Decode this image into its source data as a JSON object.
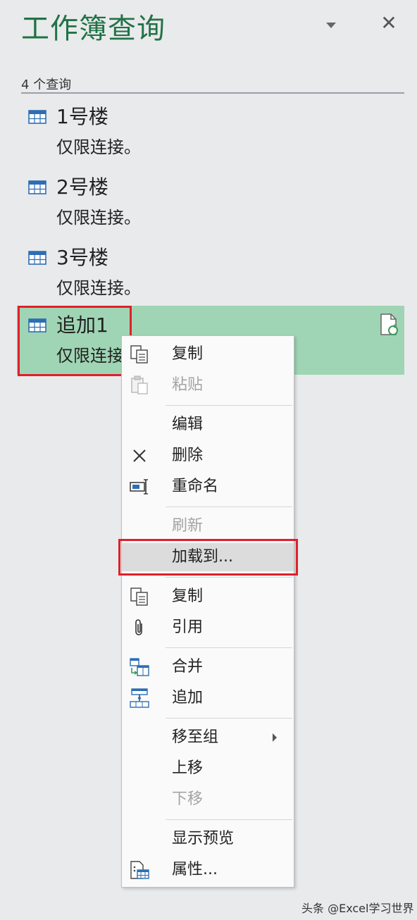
{
  "panel": {
    "title": "工作簿查询",
    "query_count": "4 个查询"
  },
  "queries": [
    {
      "name": "1号楼",
      "status": "仅限连接。"
    },
    {
      "name": "2号楼",
      "status": "仅限连接。"
    },
    {
      "name": "3号楼",
      "status": "仅限连接。"
    },
    {
      "name": "追加1",
      "status": "仅限连接。",
      "selected": true
    }
  ],
  "context_menu": {
    "items": [
      {
        "label": "复制",
        "icon": "copy-icon",
        "enabled": true
      },
      {
        "label": "粘贴",
        "icon": "paste-icon",
        "enabled": false
      },
      {
        "label": "编辑",
        "icon": "",
        "enabled": true
      },
      {
        "label": "删除",
        "icon": "delete-x-icon",
        "enabled": true
      },
      {
        "label": "重命名",
        "icon": "rename-icon",
        "enabled": true
      },
      {
        "label": "刷新",
        "icon": "",
        "enabled": false
      },
      {
        "label": "加载到...",
        "icon": "",
        "enabled": true,
        "highlighted": true
      },
      {
        "label": "复制",
        "icon": "duplicate-icon",
        "enabled": true
      },
      {
        "label": "引用",
        "icon": "paperclip-icon",
        "enabled": true
      },
      {
        "label": "合并",
        "icon": "merge-icon",
        "enabled": true
      },
      {
        "label": "追加",
        "icon": "append-icon",
        "enabled": true
      },
      {
        "label": "移至组",
        "icon": "",
        "enabled": true,
        "submenu": true
      },
      {
        "label": "上移",
        "icon": "",
        "enabled": true
      },
      {
        "label": "下移",
        "icon": "",
        "enabled": false
      },
      {
        "label": "显示预览",
        "icon": "",
        "enabled": true
      },
      {
        "label": "属性...",
        "icon": "properties-icon",
        "enabled": true
      }
    ]
  },
  "watermark": "头条 @Excel学习世界",
  "colors": {
    "title_green": "#217346",
    "selected_bg": "#9fd5b4",
    "annotation_red": "#e0202a",
    "table_icon_blue": "#2e6db4"
  }
}
